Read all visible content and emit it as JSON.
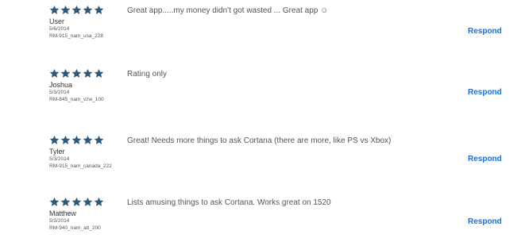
{
  "accent_color": "#1e6fc9",
  "star_color": "#2e5a79",
  "star_icon": "star-icon",
  "reviews": [
    {
      "rating": 5,
      "user": "User",
      "date": "5/6/2014",
      "device": "RM-915_nam_usa_228",
      "text": "Great app.....my money didn't got wasted ... Great app ☺",
      "respond_label": "Respond"
    },
    {
      "rating": 5,
      "user": "Joshua",
      "date": "5/3/2014",
      "device": "RM-845_nam_vzw_100",
      "text": "Rating only",
      "respond_label": "Respond"
    },
    {
      "rating": 5,
      "user": "Tyler",
      "date": "5/3/2014",
      "device": "RM-915_nam_canada_222",
      "text": "Great! Needs more things to ask Cortana (there are more, like PS vs Xbox)",
      "respond_label": "Respond"
    },
    {
      "rating": 5,
      "user": "Matthew",
      "date": "5/3/2014",
      "device": "RM-940_nam_att_200",
      "text": "Lists amusing things to ask Cortana. Works great on 1520",
      "respond_label": "Respond"
    }
  ]
}
